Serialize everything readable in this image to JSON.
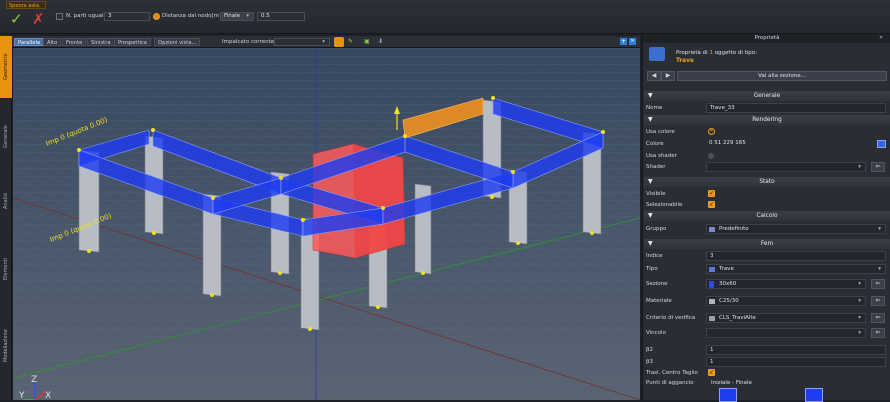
{
  "toolbar": {
    "tab_label": "Spezza asta",
    "confirm_glyph": "✓",
    "cancel_glyph": "✗",
    "equal_parts_label": "N. parti uguali",
    "equal_parts_value": "3",
    "distance_label": "Distanza dal nodo[m]",
    "end_option": "Finale",
    "distance_value": "0.5"
  },
  "left_tabs": [
    "Geometrie",
    "Generale",
    "Analisi",
    "Elementi",
    "Modellazione"
  ],
  "viewport": {
    "tabs": [
      "Parallela",
      "Alto",
      "Fronte",
      "Sinistra",
      "Prospettica"
    ],
    "options_label": "Opzioni vista...",
    "current_floor_label": "Impalcato corrente:",
    "floor_label_1": "Imp 0 (quota 0.00)",
    "floor_label_2": "Imp 0 (quota 0.00)",
    "axes": {
      "z": "Z",
      "y": "Y",
      "x": "X"
    }
  },
  "panel": {
    "title": "Proprietà",
    "object_prefix": "Proprietà di",
    "object_count": "1",
    "object_suffix": "oggetto di tipo:",
    "object_type": "Trave",
    "goto_section": "Vai alla sezione...",
    "sections": {
      "general": "Generale",
      "rendering": "Rendering",
      "state": "Stato",
      "calc": "Calcolo",
      "fem": "Fem"
    },
    "rows": {
      "name_label": "Nome",
      "name_value": "Trave_33",
      "use_color_label": "Usa colore",
      "color_label": "Colore",
      "color_value": "0 51 229 165",
      "use_shader_label": "Usa shader",
      "shader_label": "Shader",
      "visible_label": "Visibile",
      "selectable_label": "Selezionabile",
      "group_label": "Gruppo",
      "group_value": "Predefinito",
      "index_label": "Indice",
      "index_value": "3",
      "type_label": "Tipo",
      "type_value": "Trave",
      "section_label": "Sezione",
      "section_value": "30x60",
      "material_label": "Materiale",
      "material_value": "C25/30",
      "criteria_label": "Criterio di verifica",
      "criteria_value": "CLS_TraviAlte",
      "constraint_label": "Vincolo",
      "b2_label": "β2",
      "b2_value": "1",
      "b3_label": "β3",
      "b3_value": "1",
      "shear_label": "Trasl. Centro Taglio",
      "anchor_label": "Punti di aggancio",
      "anchor_value": "Iniziale - Finale"
    }
  },
  "colors": {
    "beam": "#1e3cf0",
    "selected": "#ff5a5a",
    "highlight": "#f09020",
    "accent": "#e8930e"
  }
}
